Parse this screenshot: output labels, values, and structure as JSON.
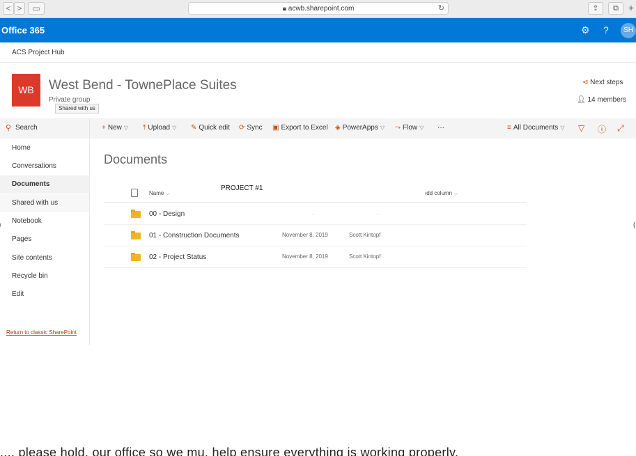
{
  "browser": {
    "url": "acwb.sharepoint.com",
    "back": "<",
    "forward": ">",
    "reload_icon": "↻",
    "share_icon": "⇪",
    "tabs_icon": "⧉",
    "plus": "+",
    "sidebar_icon": "▭"
  },
  "suite": {
    "brand": "Office 365",
    "settings_icon": "⚙",
    "help_icon": "?",
    "avatar": "SH"
  },
  "hub": {
    "name": "ACS Project Hub"
  },
  "site": {
    "logo": "WB",
    "title": "West Bend - TownePlace Suites",
    "privacy": "Private group",
    "tooltip": "Shared with us",
    "next_steps": "Next steps",
    "members": "14 members"
  },
  "commands": {
    "search": "Search",
    "new": "New",
    "upload": "Upload",
    "quick_edit": "Quick edit",
    "sync": "Sync",
    "export": "Export to Excel",
    "powerapps": "PowerApps",
    "flow": "Flow",
    "more": "···",
    "view": "All Documents"
  },
  "nav": {
    "items": [
      "Home",
      "Conversations",
      "Documents",
      "Shared with us",
      "Notebook",
      "Pages",
      "Site contents",
      "Recycle bin",
      "Edit"
    ],
    "classic_link": "Return to classic SharePoint"
  },
  "library": {
    "title": "Documents",
    "annotation": "PROJECT #1",
    "col_name": "Name",
    "col_add": "ıdd column",
    "rows": [
      {
        "name": "00 - Design",
        "date": "",
        "by": ""
      },
      {
        "name": "01 - Construction Documents",
        "date": "November 8, 2019",
        "by": "Scott Kintopf"
      },
      {
        "name": "02 - Project Status",
        "date": "November 8, 2019",
        "by": "Scott Kintopf"
      }
    ]
  },
  "footer_text": "..., please hold, our office so we mu, help ensure everything is working properly.",
  "colors": {
    "suite_bar": "#0078d7",
    "accent": "#c94f0f",
    "logo_bg": "#db3a2a"
  }
}
